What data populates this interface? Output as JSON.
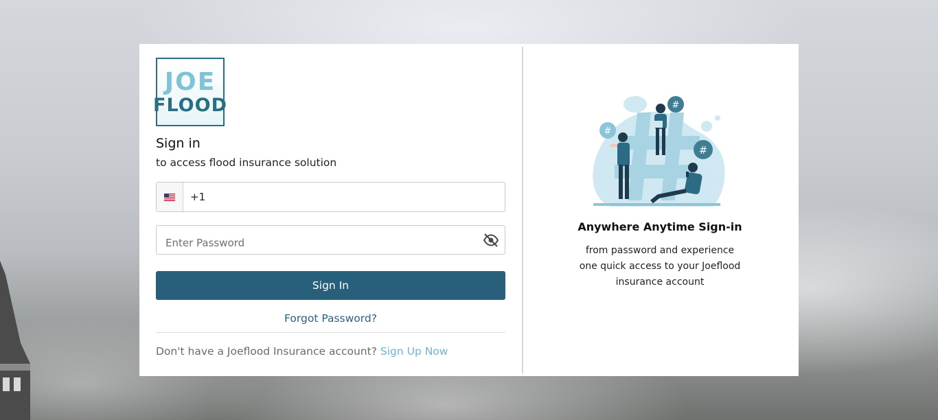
{
  "logo": {
    "line1": "JOE",
    "line2": "FLOOD"
  },
  "signin": {
    "title": "Sign in",
    "subtitle": "to access flood insurance solution",
    "phone_value": "+1",
    "password_placeholder": "Enter Password",
    "button_label": "Sign In",
    "forgot_label": "Forgot Password?",
    "signup_prompt": "Don't have a Joeflood Insurance account?",
    "signup_link": "Sign Up Now"
  },
  "promo": {
    "title": "Anywhere Anytime Sign-in",
    "line1": "from password and experience",
    "line2": "one quick access to your Joeflood",
    "line3": "insurance account"
  },
  "colors": {
    "primary": "#28607b",
    "link": "#6eb4cf",
    "forgot": "#2d5f7e",
    "illustration_light": "#bfe0ec",
    "illustration_dark": "#2a5d73"
  },
  "icons": [
    "us-flag-icon",
    "eye-slash-icon",
    "hashtag-illustration"
  ]
}
